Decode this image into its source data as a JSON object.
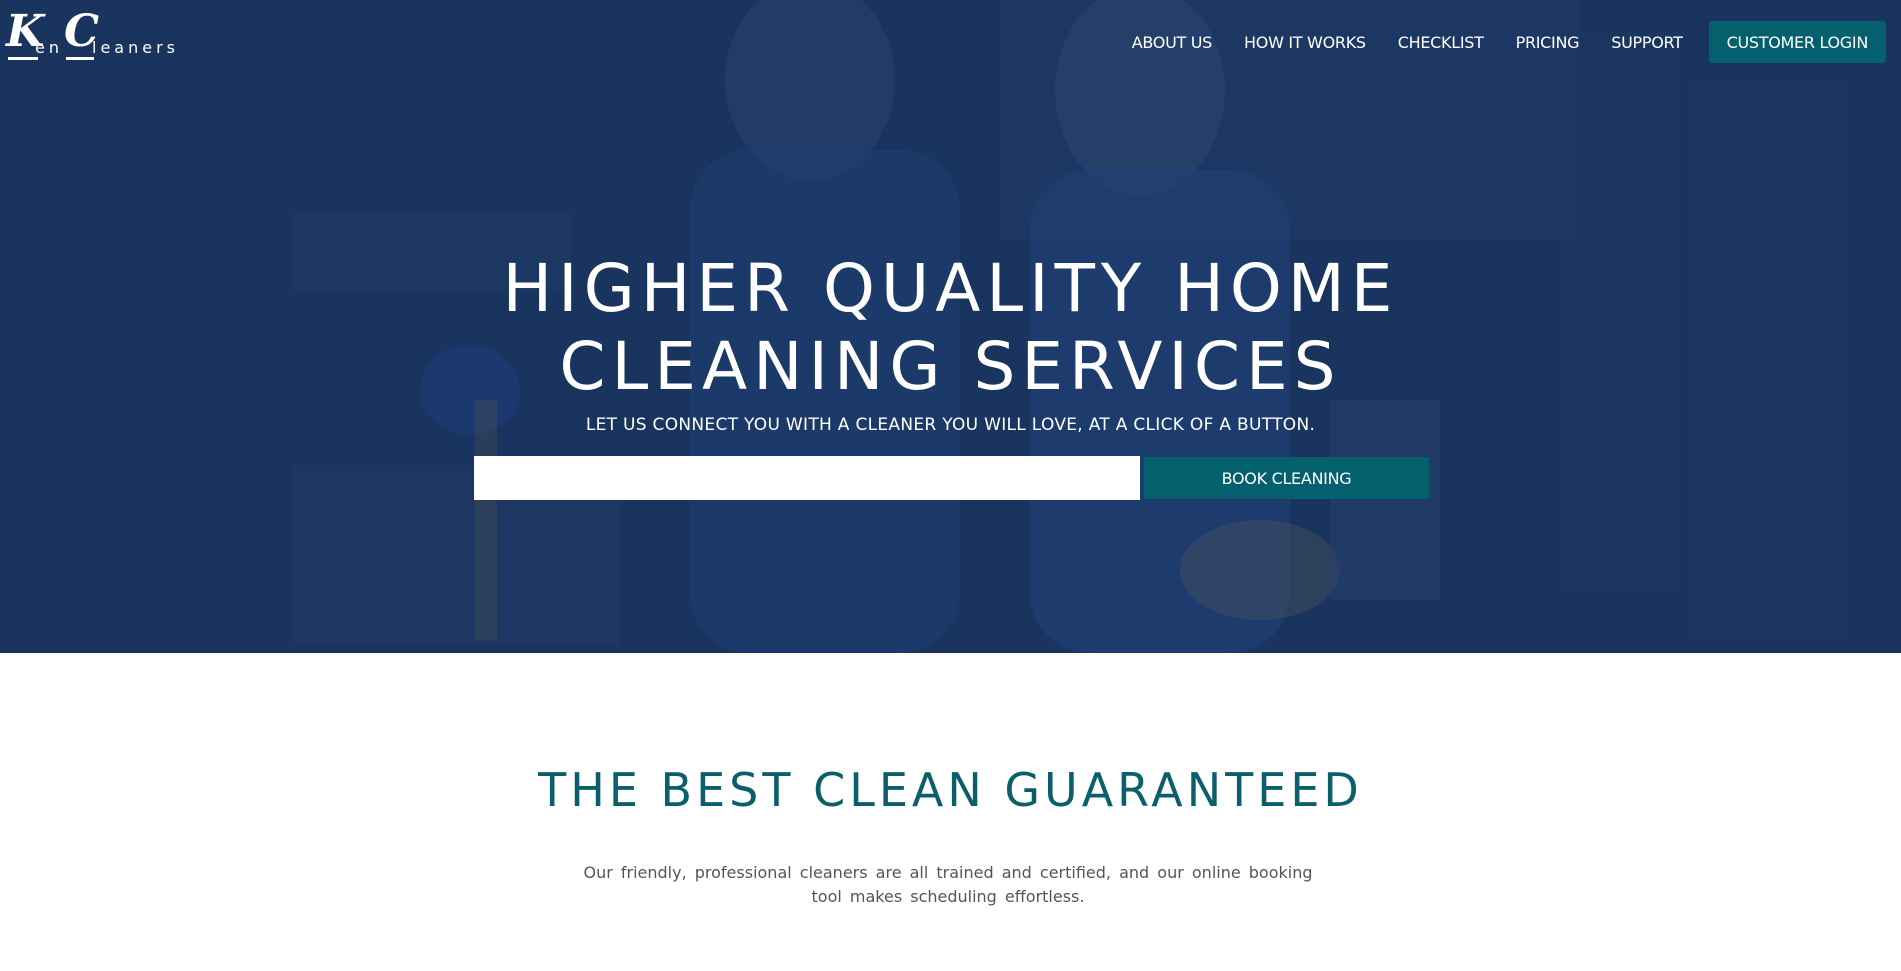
{
  "logo": {
    "big_k": "K",
    "small_en": "en",
    "big_c": "C",
    "small_leaners": "leaners"
  },
  "nav": {
    "items": [
      "ABOUT US",
      "HOW IT WORKS",
      "CHECKLIST",
      "PRICING",
      "SUPPORT"
    ],
    "login_label": "CUSTOMER LOGIN"
  },
  "hero": {
    "title_line1": "HIGHER QUALITY HOME",
    "title_line2": "CLEANING SERVICES",
    "subtitle": "LET US CONNECT YOU WITH A CLEANER YOU WILL LOVE, AT A CLICK OF A BUTTON.",
    "input_value": "",
    "book_label": "BOOK CLEANING"
  },
  "section": {
    "title": "THE BEST CLEAN GUARANTEED",
    "text": "Our friendly, professional cleaners are all trained and certified, and our online booking tool makes scheduling effortless."
  },
  "colors": {
    "hero_overlay": "#1c3866",
    "accent": "#05606e",
    "section_title": "#0b5f6c",
    "body_text": "#555555"
  }
}
